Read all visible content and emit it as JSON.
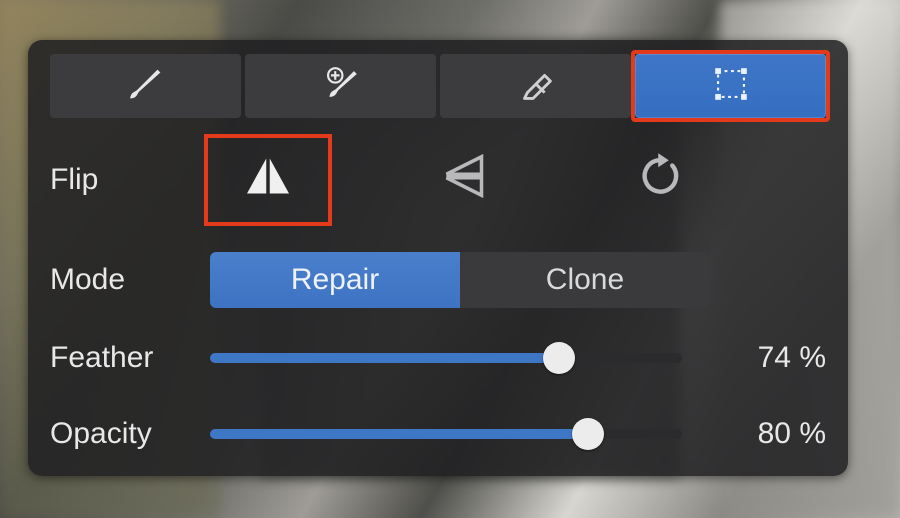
{
  "labels": {
    "flip": "Flip",
    "mode": "Mode",
    "feather": "Feather",
    "opacity": "Opacity"
  },
  "tool_tabs": {
    "active_index": 3,
    "items": [
      {
        "icon": "brush-icon"
      },
      {
        "icon": "plus-brush-icon"
      },
      {
        "icon": "eraser-icon"
      },
      {
        "icon": "marquee-icon"
      }
    ]
  },
  "flip": {
    "actions": [
      {
        "icon": "flip-horizontal-icon",
        "active": true
      },
      {
        "icon": "flip-vertical-icon",
        "active": false
      },
      {
        "icon": "reset-icon",
        "active": false
      }
    ]
  },
  "mode": {
    "options": [
      "Repair",
      "Clone"
    ],
    "selected": "Repair"
  },
  "feather": {
    "value": 74,
    "display": "74 %"
  },
  "opacity": {
    "value": 80,
    "display": "80 %"
  },
  "colors": {
    "accent_blue": "#3f77c7",
    "highlight_red": "#e33a1c",
    "panel_bg": "rgba(32,32,34,0.86)"
  }
}
